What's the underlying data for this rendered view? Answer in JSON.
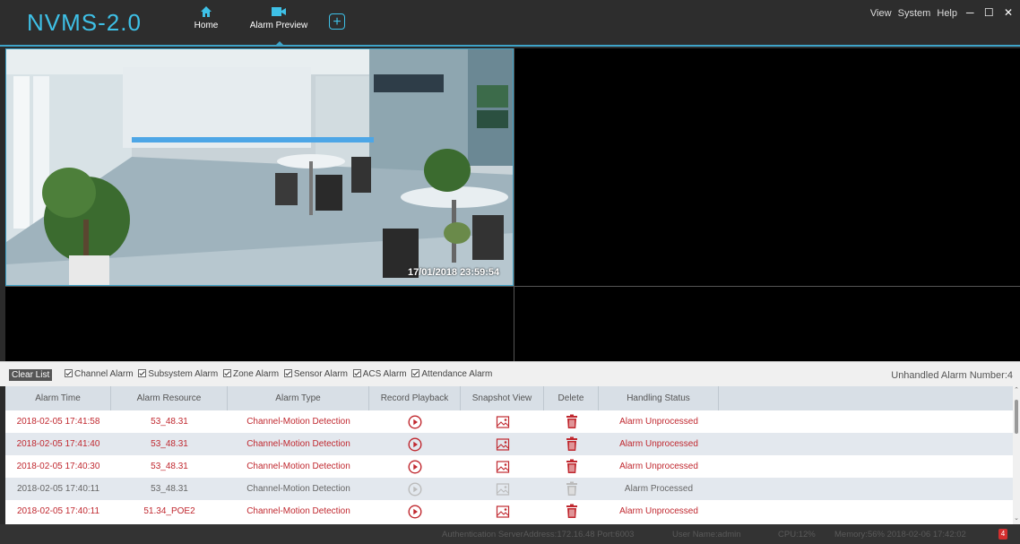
{
  "app": {
    "title": "NVMS-2.0",
    "menus": [
      "View",
      "System",
      "Help"
    ],
    "window_controls": [
      "minimize-icon",
      "maximize-icon",
      "close-icon"
    ]
  },
  "tabs": [
    {
      "label": "Home",
      "icon": "home-icon"
    },
    {
      "label": "Alarm Preview",
      "icon": "camera-icon",
      "active": true
    },
    {
      "label": "",
      "icon": "add-tab-icon"
    }
  ],
  "video": {
    "timestamp": "17/01/2018 23:59:54"
  },
  "filters": {
    "clear_label": "Clear List",
    "options": [
      {
        "label": "Channel Alarm",
        "checked": true
      },
      {
        "label": "Subsystem Alarm",
        "checked": true
      },
      {
        "label": "Zone Alarm",
        "checked": true
      },
      {
        "label": "Sensor Alarm",
        "checked": true
      },
      {
        "label": "ACS Alarm",
        "checked": true
      },
      {
        "label": "Attendance Alarm",
        "checked": true
      }
    ],
    "unhandled": "Unhandled Alarm Number:4"
  },
  "table": {
    "headers": [
      "Alarm Time",
      "Alarm Resource",
      "Alarm Type",
      "Record Playback",
      "Snapshot View",
      "Delete",
      "Handling Status"
    ],
    "rows": [
      {
        "time": "2018-02-05 17:41:58",
        "resource": "53_48.31",
        "type": "Channel-Motion Detection",
        "status": "Alarm Unprocessed",
        "processed": false
      },
      {
        "time": "2018-02-05 17:41:40",
        "resource": "53_48.31",
        "type": "Channel-Motion Detection",
        "status": "Alarm Unprocessed",
        "processed": false
      },
      {
        "time": "2018-02-05 17:40:30",
        "resource": "53_48.31",
        "type": "Channel-Motion Detection",
        "status": "Alarm Unprocessed",
        "processed": false
      },
      {
        "time": "2018-02-05 17:40:11",
        "resource": "53_48.31",
        "type": "Channel-Motion Detection",
        "status": "Alarm Processed",
        "processed": true
      },
      {
        "time": "2018-02-05 17:40:11",
        "resource": "51.34_POE2",
        "type": "Channel-Motion Detection",
        "status": "Alarm Unprocessed",
        "processed": false
      }
    ]
  },
  "status": {
    "server": "Authentication ServerAddress:172.16.48 Port:6003",
    "user": "User Name:admin",
    "cpu": "CPU:12%",
    "memory": "Memory:56% 2018-02-06 17:42:02",
    "notifications": "4"
  },
  "colors": {
    "accent": "#3ec0e6",
    "alarm_red": "#c0282f",
    "topbar": "#2d2d2d"
  }
}
